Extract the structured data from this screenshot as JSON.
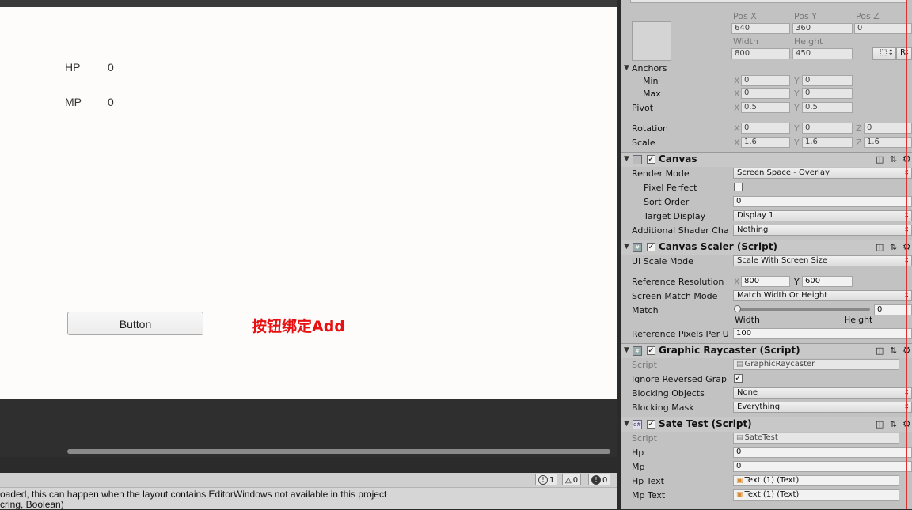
{
  "game": {
    "hp_label": "HP",
    "hp_value": "0",
    "mp_label": "MP",
    "mp_value": "0",
    "button_label": "Button",
    "annotation": "按钮绑定Add"
  },
  "console": {
    "info_count": "1",
    "warn_count": "0",
    "error_count": "0",
    "line1": "oaded, this can happen when the layout contains EditorWindows not available in this project",
    "line2": "cring, Boolean)"
  },
  "rect_transform": {
    "pos_x_label": "Pos X",
    "pos_y_label": "Pos Y",
    "pos_z_label": "Pos Z",
    "pos_x": "640",
    "pos_y": "360",
    "pos_z": "0",
    "width_label": "Width",
    "height_label": "Height",
    "width": "800",
    "height": "450",
    "r_button": "R",
    "anchors_label": "Anchors",
    "min_label": "Min",
    "min_x": "0",
    "min_y": "0",
    "max_label": "Max",
    "max_x": "0",
    "max_y": "0",
    "pivot_label": "Pivot",
    "pivot_x": "0.5",
    "pivot_y": "0.5",
    "rotation_label": "Rotation",
    "rot_x": "0",
    "rot_y": "0",
    "rot_z": "0",
    "scale_label": "Scale",
    "scale_x": "1.6",
    "scale_y": "1.6",
    "scale_z": "1.6",
    "axis_x": "X",
    "axis_y": "Y",
    "axis_z": "Z"
  },
  "canvas": {
    "title": "Canvas",
    "render_mode_label": "Render Mode",
    "render_mode": "Screen Space - Overlay",
    "pixel_perfect_label": "Pixel Perfect",
    "sort_order_label": "Sort Order",
    "sort_order": "0",
    "target_display_label": "Target Display",
    "target_display": "Display 1",
    "shader_channels_label": "Additional Shader Cha",
    "shader_channels": "Nothing"
  },
  "canvas_scaler": {
    "title": "Canvas Scaler (Script)",
    "ui_scale_mode_label": "UI Scale Mode",
    "ui_scale_mode": "Scale With Screen Size",
    "ref_res_label": "Reference Resolution",
    "ref_res_x": "800",
    "ref_res_y": "600",
    "screen_match_label": "Screen Match Mode",
    "screen_match": "Match Width Or Height",
    "match_label": "Match",
    "match_value": "0",
    "match_fraction": 0,
    "match_left": "Width",
    "match_right": "Height",
    "ref_ppu_label": "Reference Pixels Per U",
    "ref_ppu": "100"
  },
  "raycaster": {
    "title": "Graphic Raycaster (Script)",
    "script_label": "Script",
    "script": "GraphicRaycaster",
    "ignore_label": "Ignore Reversed Grap",
    "blocking_objects_label": "Blocking Objects",
    "blocking_objects": "None",
    "blocking_mask_label": "Blocking Mask",
    "blocking_mask": "Everything"
  },
  "sate_test": {
    "title": "Sate Test (Script)",
    "script_label": "Script",
    "script": "SateTest",
    "hp_label": "Hp",
    "hp": "0",
    "mp_label": "Mp",
    "mp": "0",
    "hp_text_label": "Hp Text",
    "hp_text": "Text (1) (Text)",
    "mp_text_label": "Mp Text",
    "mp_text": "Text (1) (Text)"
  },
  "colors": {
    "annotation": "#e81010",
    "inspector_bg": "#c2c2c2",
    "game_bg": "#fdfcfb"
  }
}
